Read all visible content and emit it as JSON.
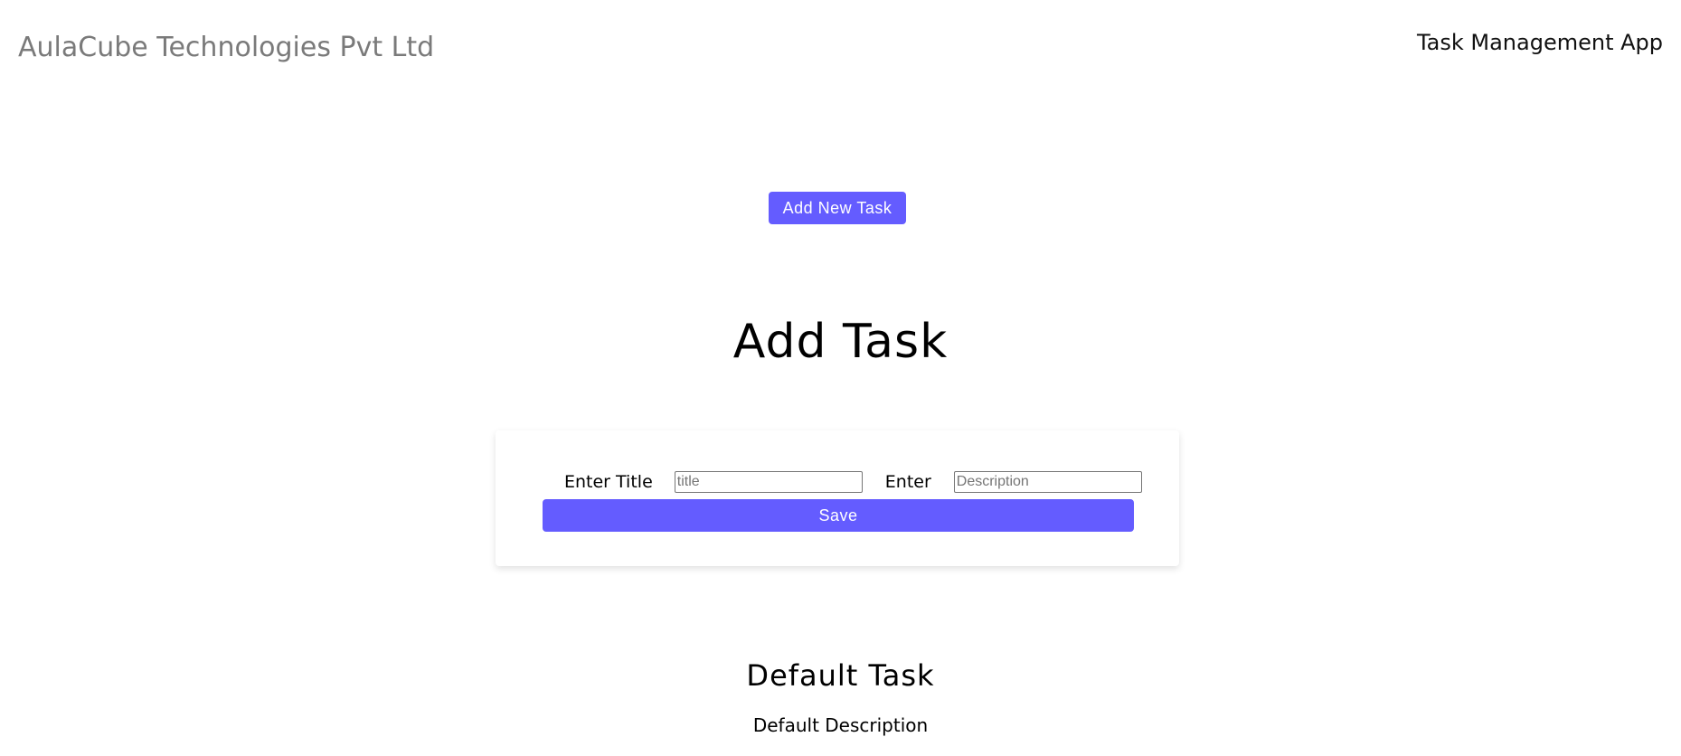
{
  "header": {
    "brand": "AulaCube Technologies Pvt Ltd",
    "app_title": "Task Management App"
  },
  "toolbar": {
    "add_new_task_label": "Add New Task"
  },
  "form": {
    "heading": "Add Task",
    "title_label": "Enter Title",
    "title_placeholder": "title",
    "title_value": "",
    "description_label": "Enter",
    "description_placeholder": "Description",
    "description_value": "",
    "save_label": "Save"
  },
  "tasks": [
    {
      "title": "Default Task",
      "description": "Default Description"
    }
  ],
  "colors": {
    "accent": "#645cff",
    "brand_text": "#7a7a7a"
  }
}
